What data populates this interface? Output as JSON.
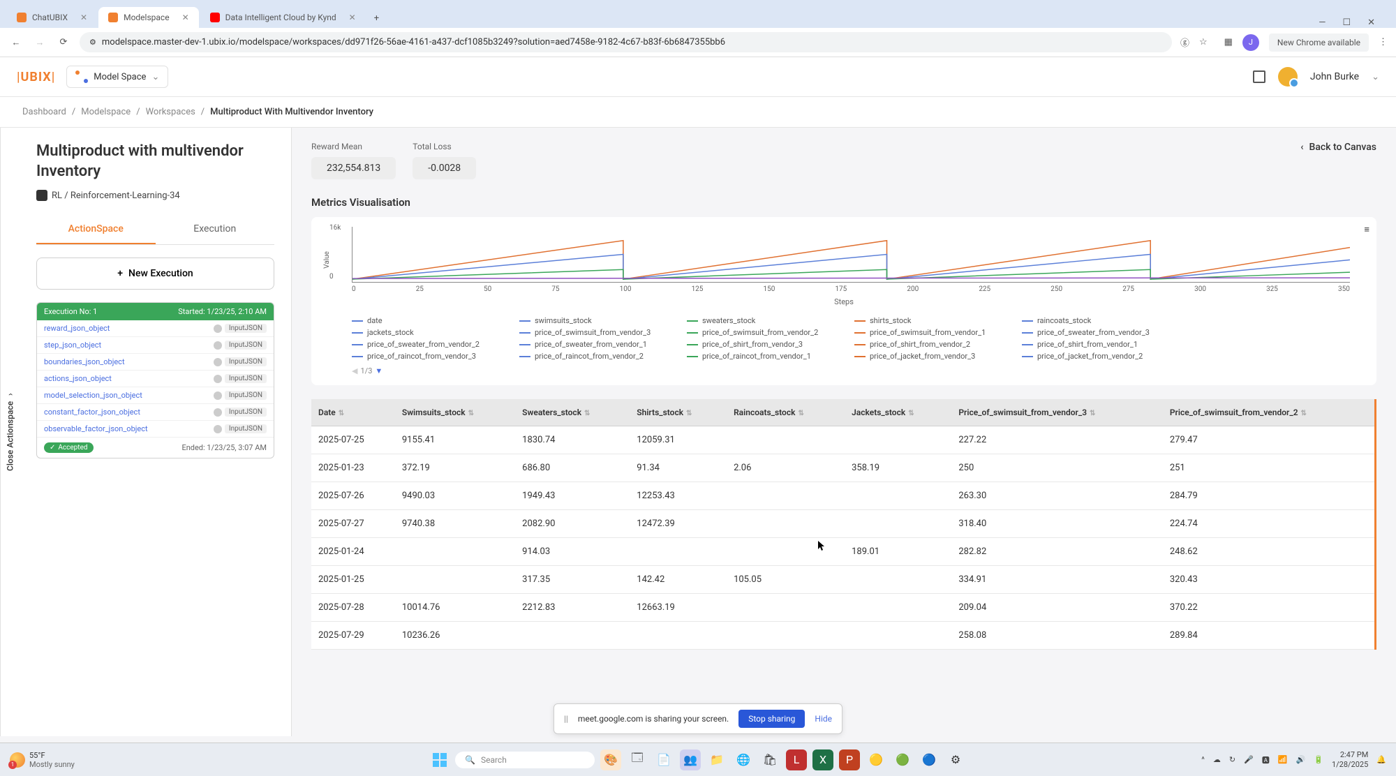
{
  "browser": {
    "tabs": [
      {
        "title": "ChatUBIX",
        "icon_bg": "#f08030"
      },
      {
        "title": "Modelspace",
        "icon_bg": "#f08030",
        "active": true
      },
      {
        "title": "Data Intelligent Cloud by Kynd",
        "icon_bg": "#ff0000"
      }
    ],
    "url": "modelspace.master-dev-1.ubix.io/modelspace/workspaces/dd971f26-56ae-4161-a437-dcf1085b3249?solution=aed7458e-9182-4c67-b83f-6b6847355bb6",
    "new_chrome": "New Chrome available",
    "avatar_letter": "J"
  },
  "header": {
    "logo": "|UBIX|",
    "model_space": "Model Space",
    "user_name": "John Burke"
  },
  "breadcrumb": {
    "items": [
      "Dashboard",
      "Modelspace",
      "Workspaces",
      "Multiproduct With Multivendor Inventory"
    ]
  },
  "page": {
    "title": "Multiproduct with multivendor Inventory",
    "rl_label": "RL / Reinforcement-Learning-34",
    "tabs": {
      "action_space": "ActionSpace",
      "execution": "Execution"
    },
    "new_execution": "New Execution",
    "back_to_canvas": "Back to Canvas"
  },
  "execution": {
    "header_left": "Execution No: 1",
    "header_right": "Started: 1/23/25, 2:10 AM",
    "items": [
      "reward_json_object",
      "step_json_object",
      "boundaries_json_object",
      "actions_json_object",
      "model_selection_json_object",
      "constant_factor_json_object",
      "observable_factor_json_object"
    ],
    "tag": "InputJSON",
    "accepted": "Accepted",
    "ended": "Ended: 1/23/25, 3:07 AM"
  },
  "metrics": {
    "reward_mean_label": "Reward Mean",
    "reward_mean_value": "232,554.813",
    "total_loss_label": "Total Loss",
    "total_loss_value": "-0.0028",
    "section_title": "Metrics Visualisation"
  },
  "chart_data": {
    "type": "line",
    "title": "",
    "xlabel": "Steps",
    "ylabel": "Value",
    "ylim": [
      0,
      16000
    ],
    "y_tick_top": "16k",
    "y_tick_bottom": "0",
    "x_ticks": [
      "0",
      "25",
      "50",
      "75",
      "100",
      "125",
      "150",
      "175",
      "200",
      "225",
      "250",
      "275",
      "300",
      "325",
      "350"
    ],
    "legend_columns": [
      [
        {
          "label": "date",
          "color": "#5b7fd8"
        },
        {
          "label": "jackets_stock",
          "color": "#5b7fd8"
        },
        {
          "label": "price_of_sweater_from_vendor_2",
          "color": "#5b7fd8"
        },
        {
          "label": "price_of_raincot_from_vendor_3",
          "color": "#5b7fd8"
        }
      ],
      [
        {
          "label": "swimsuits_stock",
          "color": "#5b7fd8"
        },
        {
          "label": "price_of_swimsuit_from_vendor_3",
          "color": "#5b7fd8"
        },
        {
          "label": "price_of_sweater_from_vendor_1",
          "color": "#5b7fd8"
        },
        {
          "label": "price_of_raincot_from_vendor_2",
          "color": "#5b7fd8"
        }
      ],
      [
        {
          "label": "sweaters_stock",
          "color": "#3aa659"
        },
        {
          "label": "price_of_swimsuit_from_vendor_2",
          "color": "#3aa659"
        },
        {
          "label": "price_of_shirt_from_vendor_3",
          "color": "#3aa659"
        },
        {
          "label": "price_of_raincot_from_vendor_1",
          "color": "#3aa659"
        }
      ],
      [
        {
          "label": "shirts_stock",
          "color": "#e07030"
        },
        {
          "label": "price_of_swimsuit_from_vendor_1",
          "color": "#e07030"
        },
        {
          "label": "price_of_shirt_from_vendor_2",
          "color": "#e07030"
        },
        {
          "label": "price_of_jacket_from_vendor_3",
          "color": "#e07030"
        }
      ],
      [
        {
          "label": "raincoats_stock",
          "color": "#5b7fd8"
        },
        {
          "label": "price_of_sweater_from_vendor_3",
          "color": "#5b7fd8"
        },
        {
          "label": "price_of_shirt_from_vendor_1",
          "color": "#5b7fd8"
        },
        {
          "label": "price_of_jacket_from_vendor_2",
          "color": "#5b7fd8"
        }
      ]
    ],
    "pager": "1/3"
  },
  "table": {
    "columns": [
      "Date",
      "Swimsuits_stock",
      "Sweaters_stock",
      "Shirts_stock",
      "Raincoats_stock",
      "Jackets_stock",
      "Price_of_swimsuit_from_vendor_3",
      "Price_of_swimsuit_from_vendor_2"
    ],
    "rows": [
      [
        "2025-07-25",
        "9155.41",
        "1830.74",
        "12059.31",
        "",
        "",
        "227.22",
        "279.47"
      ],
      [
        "2025-01-23",
        "372.19",
        "686.80",
        "91.34",
        "2.06",
        "358.19",
        "250",
        "251"
      ],
      [
        "2025-07-26",
        "9490.03",
        "1949.43",
        "12253.43",
        "",
        "",
        "263.30",
        "284.79"
      ],
      [
        "2025-07-27",
        "9740.38",
        "2082.90",
        "12472.39",
        "",
        "",
        "318.40",
        "224.74"
      ],
      [
        "2025-01-24",
        "",
        "914.03",
        "",
        "",
        "189.01",
        "282.82",
        "248.62"
      ],
      [
        "2025-01-25",
        "",
        "317.35",
        "142.42",
        "105.05",
        "",
        "334.91",
        "320.43"
      ],
      [
        "2025-07-28",
        "10014.76",
        "2212.83",
        "12663.19",
        "",
        "",
        "209.04",
        "370.22"
      ],
      [
        "2025-07-29",
        "10236.26",
        "",
        "",
        "",
        "",
        "258.08",
        "289.84"
      ]
    ]
  },
  "sidebar_collapse": "Close Actionspace",
  "share": {
    "text": "meet.google.com is sharing your screen.",
    "stop": "Stop sharing",
    "hide": "Hide"
  },
  "taskbar": {
    "temp": "55°F",
    "weather": "Mostly sunny",
    "search_placeholder": "Search",
    "time": "2:47 PM",
    "date": "1/28/2025"
  }
}
